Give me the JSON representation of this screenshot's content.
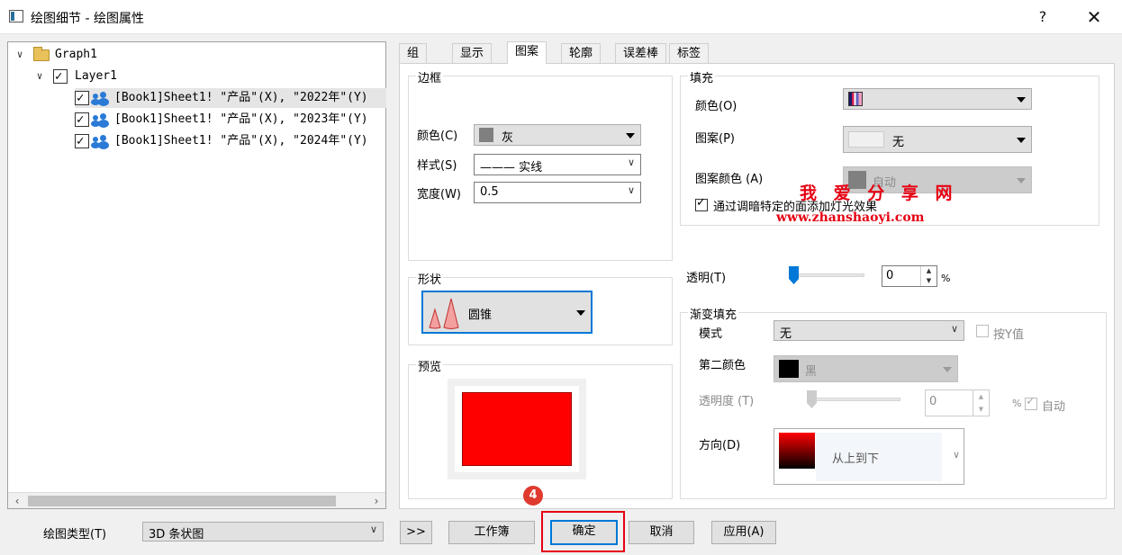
{
  "window": {
    "title": "绘图细节 - 绘图属性",
    "help": "?",
    "close": "✕"
  },
  "tree": {
    "root": "Graph1",
    "layer": "Layer1",
    "items": [
      "[Book1]Sheet1! \"产品\"(X), \"2022年\"(Y)",
      "[Book1]Sheet1! \"产品\"(X), \"2023年\"(Y)",
      "[Book1]Sheet1! \"产品\"(X), \"2024年\"(Y)"
    ]
  },
  "tabs": [
    "组",
    "显示",
    "图案",
    "轮廓",
    "误差棒",
    "标签"
  ],
  "border": {
    "title": "边框",
    "color_label": "颜色(C)",
    "color_value": "灰",
    "color_hex": "#808080",
    "style_label": "样式(S)",
    "style_value": "——— 实线",
    "width_label": "宽度(W)",
    "width_value": "0.5"
  },
  "fill": {
    "title": "填充",
    "color_label": "颜色(O)",
    "pattern_label": "图案(P)",
    "pattern_value": "无",
    "pattern_color_label": "图案颜色 (A)",
    "pattern_color_value": "自动",
    "lighting_label": "通过调暗特定的面添加灯光效果",
    "lighting_checked": true
  },
  "shape": {
    "title": "形状",
    "value": "圆锥",
    "icon_color": "#f08080"
  },
  "preview": {
    "title": "预览",
    "fill_hex": "#ff0000"
  },
  "transparency": {
    "label": "透明(T)",
    "value": "0",
    "unit": "%",
    "level": 0
  },
  "gradient": {
    "title": "渐变填充",
    "mode_label": "模式",
    "mode_value": "无",
    "by_y_label": "按Y值",
    "second_color_label": "第二颜色",
    "second_color_value": "黑",
    "second_color_hex": "#000000",
    "opacity_label": "透明度 (T)",
    "opacity_value": "0",
    "opacity_unit": "%",
    "auto_label": "自动",
    "direction_label": "方向(D)",
    "direction_value": "从上到下"
  },
  "bottom": {
    "plot_type_label": "绘图类型(T)",
    "plot_type_value": "3D 条状图",
    "more": ">>",
    "workbook": "工作簿",
    "ok": "确定",
    "cancel": "取消",
    "apply": "应用(A)"
  },
  "annotation": {
    "step": "4"
  },
  "watermark": {
    "text": "我 爱 分 享 网",
    "url": "www.zhanshaoyi.com"
  }
}
